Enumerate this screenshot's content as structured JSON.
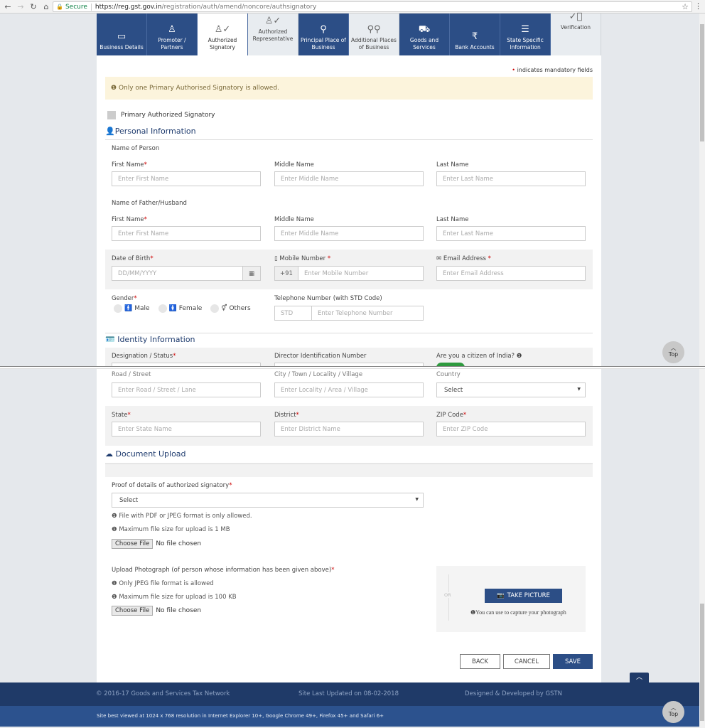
{
  "browser": {
    "secure_label": "Secure",
    "url_host": "https://reg.gst.gov.in",
    "url_path": "/registration/auth/amend/noncore/authsignatory",
    "back_icon": "arrow-left-icon",
    "forward_icon": "arrow-right-icon",
    "reload_icon": "reload-icon",
    "home_icon": "home-icon"
  },
  "tabs": [
    {
      "label": "Business Details",
      "icon": "briefcase-icon",
      "state": "completed"
    },
    {
      "label": "Promoter / Partners",
      "icon": "person-icon",
      "state": "completed"
    },
    {
      "label": "Authorized Signatory",
      "icon": "person-check-icon",
      "state": "active"
    },
    {
      "label": "Authorized Representative",
      "icon": "person-check-icon",
      "state": "pending"
    },
    {
      "label": "Principal Place of Business",
      "icon": "location-pin-icon",
      "state": "completed"
    },
    {
      "label": "Additional Places of Business",
      "icon": "location-pins-icon",
      "state": "pending"
    },
    {
      "label": "Goods and Services",
      "icon": "hand-truck-icon",
      "state": "completed"
    },
    {
      "label": "Bank Accounts",
      "icon": "rupee-coin-icon",
      "state": "completed"
    },
    {
      "label": "State Specific Information",
      "icon": "list-card-icon",
      "state": "completed"
    },
    {
      "label": "Verification",
      "icon": "check-circle-icon",
      "state": "pending"
    }
  ],
  "form": {
    "mandatory_note": "indicates mandatory fields",
    "alert": "Only one Primary Authorised Signatory is allowed.",
    "primary_checkbox_label": "Primary Authorized Signatory",
    "personal_section": "Personal Information",
    "name_of_person": "Name of Person",
    "name_of_father": "Name of Father/Husband",
    "first_name_label": "First Name",
    "middle_name_label": "Middle Name",
    "last_name_label": "Last Name",
    "first_name_ph": "Enter First Name",
    "middle_name_ph": "Enter Middle Name",
    "last_name_ph": "Enter Last Name",
    "dob_label": "Date of Birth",
    "dob_ph": "DD/MM/YYYY",
    "mobile_label": "Mobile Number",
    "mobile_prefix": "+91",
    "mobile_ph": "Enter Mobile Number",
    "email_label": "Email Address",
    "email_ph": "Enter Email Address",
    "gender_label": "Gender",
    "gender_options": [
      "Male",
      "Female",
      "Others"
    ],
    "telephone_label": "Telephone Number (with STD Code)",
    "std_ph": "STD",
    "telephone_ph": "Enter Telephone Number",
    "identity_section": "Identity Information",
    "designation_label": "Designation / Status",
    "din_label": "Director Identification Number",
    "citizen_label": "Are you a citizen of India?",
    "citizen_value": true,
    "road_label": "Road / Street",
    "road_ph": "Enter Road / Street / Lane",
    "city_label": "City / Town / Locality / Village",
    "city_ph": "Enter Locality / Area / Village",
    "country_label": "Country",
    "country_value": "Select",
    "state_label": "State",
    "state_ph": "Enter State Name",
    "district_label": "District",
    "district_ph": "Enter District Name",
    "zip_label": "ZIP Code",
    "zip_ph": "Enter ZIP Code",
    "document_section": "Document Upload",
    "proof_label": "Proof of details of authorized signatory",
    "proof_value": "Select",
    "proof_info1": "File with PDF or JPEG format is only allowed.",
    "proof_info2": "Maximum file size for upload is 1 MB",
    "choose_file": "Choose File",
    "no_file": "No file chosen",
    "photo_label": "Upload Photograph (of person whose information has been given above)",
    "photo_info1": "Only JPEG file format is allowed",
    "photo_info2": "Maximum file size for upload is 100 KB",
    "or_text": "OR",
    "take_picture": "TAKE PICTURE",
    "capture_note": "You can use to capture your photograph",
    "back_button": "BACK",
    "cancel_button": "CANCEL",
    "save_button": "SAVE"
  },
  "top_button": "Top",
  "footer": {
    "copyright": "© 2016-17 Goods and Services Tax Network",
    "last_updated": "Site Last Updated on 08-02-2018",
    "developed_by": "Designed & Developed by GSTN",
    "best_viewed": "Site best viewed at 1024 x 768 resolution in Internet Explorer 10+, Google Chrome 49+, Firefox 45+ and Safari 6+"
  },
  "colors": {
    "brand_navy": "#2c4e86",
    "footer_dark": "#1f3a68",
    "alert_bg": "#fcf4dc",
    "toggle_on": "#2e9a3e",
    "required": "#cc0000"
  }
}
